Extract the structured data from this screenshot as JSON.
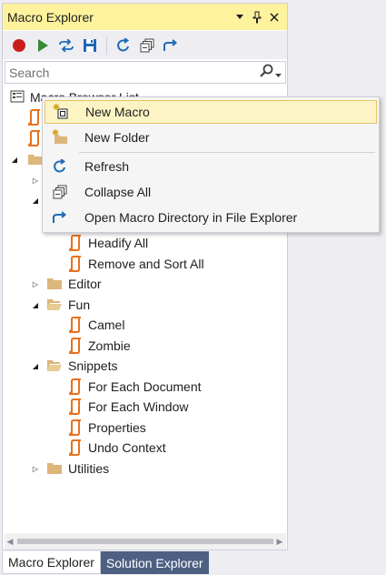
{
  "window": {
    "title": "Macro Explorer"
  },
  "search": {
    "placeholder": "Search"
  },
  "tree": {
    "root_label": "Macro Browser List",
    "items": [
      {
        "label": "Headify All"
      },
      {
        "label": "Remove and Sort All"
      },
      {
        "label": "Editor"
      },
      {
        "label": "Fun"
      },
      {
        "label": "Camel"
      },
      {
        "label": "Zombie"
      },
      {
        "label": "Snippets"
      },
      {
        "label": "For Each Document"
      },
      {
        "label": "For Each Window"
      },
      {
        "label": "Properties"
      },
      {
        "label": "Undo Context"
      },
      {
        "label": "Utilities"
      }
    ]
  },
  "context_menu": {
    "items": [
      {
        "label": "New Macro",
        "icon": "new-macro-icon"
      },
      {
        "label": "New Folder",
        "icon": "new-folder-icon"
      },
      {
        "label": "Refresh",
        "icon": "refresh-icon"
      },
      {
        "label": "Collapse All",
        "icon": "collapse-all-icon"
      },
      {
        "label": "Open Macro Directory in File Explorer",
        "icon": "open-directory-icon"
      }
    ]
  },
  "tabs": [
    {
      "label": "Macro Explorer",
      "active": true
    },
    {
      "label": "Solution Explorer",
      "active": false
    }
  ],
  "colors": {
    "title_bar": "#fff29d",
    "tab_inactive": "#4d6082",
    "macro_icon": "#e8711c",
    "folder": "#dcb67a",
    "accent_blue": "#1e6ab8",
    "menu_highlight": "#fcf4c4"
  }
}
